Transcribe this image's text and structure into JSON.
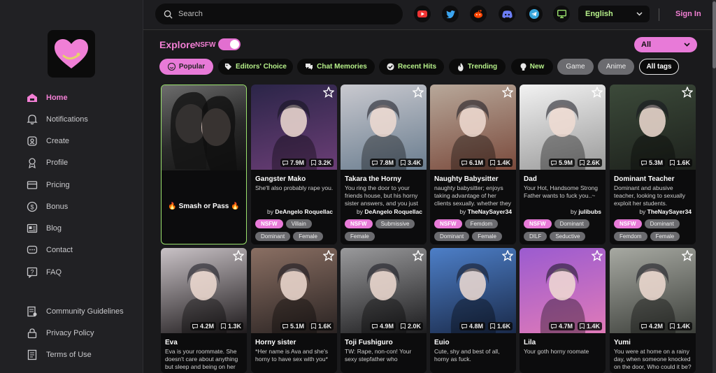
{
  "search": {
    "placeholder": "Search"
  },
  "language": {
    "selected": "English"
  },
  "auth": {
    "signin_label": "Sign In"
  },
  "social_icons": [
    "youtube-icon",
    "twitter-icon",
    "reddit-icon",
    "discord-icon",
    "telegram-icon",
    "desktop-icon"
  ],
  "sidebar": {
    "items": [
      {
        "label": "Home",
        "icon": "home-icon",
        "active": true
      },
      {
        "label": "Notifications",
        "icon": "bell-icon"
      },
      {
        "label": "Create",
        "icon": "create-icon"
      },
      {
        "label": "Profile",
        "icon": "profile-icon"
      },
      {
        "label": "Pricing",
        "icon": "pricing-icon"
      },
      {
        "label": "Bonus",
        "icon": "bonus-icon"
      },
      {
        "label": "Blog",
        "icon": "blog-icon"
      },
      {
        "label": "Contact",
        "icon": "contact-icon"
      },
      {
        "label": "FAQ",
        "icon": "faq-icon"
      }
    ],
    "footer_items": [
      {
        "label": "Community Guidelines",
        "icon": "guidelines-icon"
      },
      {
        "label": "Privacy Policy",
        "icon": "lock-icon"
      },
      {
        "label": "Terms of Use",
        "icon": "document-icon"
      }
    ]
  },
  "explore": {
    "title": "Explore",
    "nsfw_label": "NSFW",
    "nsfw_enabled": true,
    "filter_selected": "All"
  },
  "tags": [
    {
      "label": "Popular",
      "style": "pink",
      "icon": "smile-icon"
    },
    {
      "label": "Editors' Choice",
      "style": "dark",
      "icon": "tag-icon"
    },
    {
      "label": "Chat Memories",
      "style": "dark",
      "icon": "chat-icon"
    },
    {
      "label": "Recent Hits",
      "style": "dark",
      "icon": "check-icon"
    },
    {
      "label": "Trending",
      "style": "dark",
      "icon": "fire-icon"
    },
    {
      "label": "New",
      "style": "dark",
      "icon": "bulb-icon"
    },
    {
      "label": "Game",
      "style": "gray"
    },
    {
      "label": "Anime",
      "style": "gray"
    },
    {
      "label": "All tags",
      "style": "outline"
    }
  ],
  "featured": {
    "label": "🔥 Smash or Pass 🔥"
  },
  "cards": [
    {
      "name": "Gangster Mako",
      "desc": "She'll also probably rape you.",
      "author_prefix": "by",
      "author": "DeAngelo Roquellac",
      "views": "7.9M",
      "saves": "3.2K",
      "chips": [
        "NSFW",
        "Villain",
        "Dominant",
        "Female"
      ],
      "colors": [
        "#2b2548",
        "#6b3e76"
      ]
    },
    {
      "name": "Takara the Horny",
      "desc": "You ring the door to your friends house, but his horny sister answers, and you just",
      "author_prefix": "by",
      "author": "DeAngelo Roquellac",
      "views": "7.8M",
      "saves": "3.4K",
      "chips": [
        "NSFW",
        "Submissive",
        "Female"
      ],
      "colors": [
        "#c9c9cf",
        "#6a7d8f"
      ]
    },
    {
      "name": "Naughty Babysitter",
      "desc": "naughty babysitter; enjoys taking advantage of her clients sexually. whether they",
      "author_prefix": "by",
      "author": "TheNaySayer34",
      "views": "6.1M",
      "saves": "1.4K",
      "chips": [
        "NSFW",
        "Femdom",
        "Dominant",
        "Female"
      ],
      "colors": [
        "#b8a89a",
        "#7a4a3c"
      ]
    },
    {
      "name": "Dad",
      "desc": "Your Hot, Handsome Strong Father wants to fuck you..~",
      "author_prefix": "by",
      "author": "julibubs",
      "views": "5.9M",
      "saves": "2.6K",
      "chips": [
        "NSFW",
        "Dominant",
        "DILF",
        "Seductive"
      ],
      "colors": [
        "#f2f2f2",
        "#9a9a9a"
      ]
    },
    {
      "name": "Dominant Teacher",
      "desc": "Dominant and abusive teacher, looking to sexually exploit her students.",
      "author_prefix": "by",
      "author": "TheNaySayer34",
      "views": "5.3M",
      "saves": "1.6K",
      "chips": [
        "NSFW",
        "Dominant",
        "Femdom",
        "Female"
      ],
      "colors": [
        "#3c4a3a",
        "#1d211c"
      ]
    },
    {
      "name": "Eva",
      "desc": "Eva is your roommate. She doesn't care about anything but sleep and being on her",
      "views": "4.2M",
      "saves": "1.3K",
      "colors": [
        "#c9c2c6",
        "#1e1a1c"
      ]
    },
    {
      "name": "Horny sister",
      "desc": "*Her name is Ava and she's horny to have sex with you*",
      "views": "5.1M",
      "saves": "1.6K",
      "colors": [
        "#8a6f63",
        "#2a2322"
      ]
    },
    {
      "name": "Toji Fushiguro",
      "desc": "TW: Rape, non-con! Your sexy stepfather who",
      "views": "4.9M",
      "saves": "2.0K",
      "colors": [
        "#9a9a9c",
        "#1c1c1e"
      ]
    },
    {
      "name": "Euio",
      "desc": "Cute, shy and best of all, horny as fuck.",
      "views": "4.8M",
      "saves": "1.6K",
      "colors": [
        "#4d7fc8",
        "#1a2a4a"
      ]
    },
    {
      "name": "Lila",
      "desc": "Your goth horny roomate",
      "views": "4.7M",
      "saves": "1.4K",
      "colors": [
        "#9b5bd0",
        "#e07ab8"
      ]
    },
    {
      "name": "Yumi",
      "desc": "You were at home on a rainy day, when someone knocked on the door, Who could it be?",
      "views": "4.2M",
      "saves": "1.4K",
      "colors": [
        "#a7a9a2",
        "#3c3f3a"
      ]
    }
  ]
}
